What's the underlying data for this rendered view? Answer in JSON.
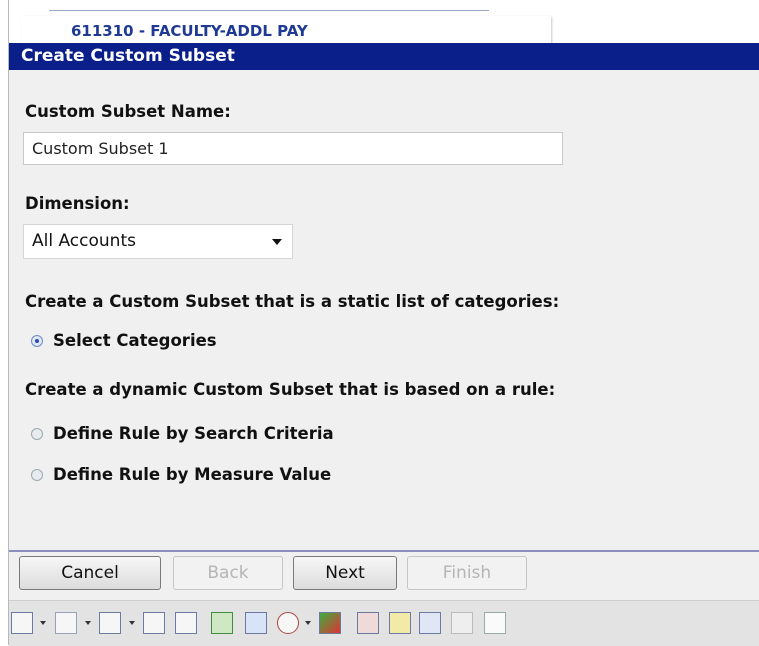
{
  "background_row": {
    "account_label": "611310 - FACULTY-ADDL PAY"
  },
  "dialog": {
    "title": "Create Custom Subset",
    "name_label": "Custom Subset Name:",
    "name_value": "Custom Subset 1",
    "dimension_label": "Dimension:",
    "dimension_value": "All Accounts",
    "static_heading": "Create a Custom Subset that is a static list of categories:",
    "dynamic_heading": "Create a dynamic Custom Subset that is based on a rule:",
    "options": [
      {
        "label": "Select Categories",
        "checked": true
      },
      {
        "label": "Define Rule by Search Criteria",
        "checked": false
      },
      {
        "label": "Define Rule by Measure Value",
        "checked": false
      }
    ],
    "buttons": {
      "cancel": "Cancel",
      "back": "Back",
      "next": "Next",
      "finish": "Finish"
    }
  },
  "toolbar": {
    "icons": [
      "grid-icon",
      "bar-chart-icon",
      "chart-table-icon",
      "export-icon",
      "column-icon",
      "green-table-icon",
      "list-icon",
      "no-entry-icon",
      "color-scale-icon",
      "tiles-icon",
      "eye-icon",
      "add-icon",
      "wand-icon",
      "document-icon"
    ]
  },
  "colors": {
    "title_bar": "#0a1f8a",
    "panel_bg": "#f0f0f0",
    "link_blue": "#1f3a93"
  }
}
